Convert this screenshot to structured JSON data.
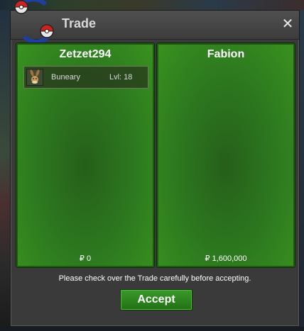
{
  "window": {
    "title": "Trade",
    "close_label": "✕",
    "accept_label": "Accept",
    "notice": "Please check over the Trade carefully before accepting."
  },
  "left_panel": {
    "player": "Zetzet294",
    "money": "₽ 0",
    "items": [
      {
        "name": "Buneary",
        "level": "Lvl: 18"
      }
    ]
  },
  "right_panel": {
    "player": "Fabion",
    "money": "₽ 1,600,000",
    "items": []
  },
  "colors": {
    "panel_green": "#2d7a1f",
    "accept_green": "#2e8a22",
    "window_gray": "#3a3a3a"
  },
  "icons": [
    "pokeball-logo-icon",
    "close-icon",
    "buneary-icon"
  ]
}
